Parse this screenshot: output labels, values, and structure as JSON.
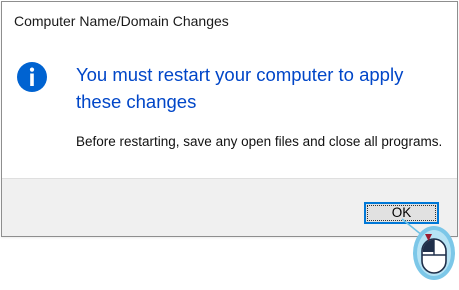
{
  "dialog": {
    "title": "Computer Name/Domain Changes",
    "icon": "info-icon",
    "heading": "You must restart your computer to apply these changes",
    "body": "Before restarting, save any open files and close all programs.",
    "ok_label": "OK"
  },
  "colors": {
    "heading": "#0046c8",
    "icon": "#0063d1",
    "button_border": "#0078d7",
    "footer": "#f0f0f0",
    "mouse_badge": "#79c8e8",
    "mouse_button": "#9b1b30"
  },
  "overlay": {
    "icon": "mouse-left-click-icon"
  }
}
